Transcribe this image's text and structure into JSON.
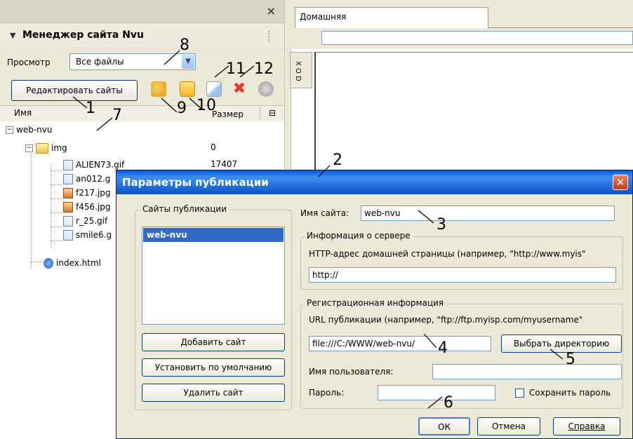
{
  "site_manager": {
    "title": "Менеджер сайта Nvu",
    "close_glyph": "×",
    "view_label": "Просмотр",
    "view_select_value": "Все файлы",
    "edit_sites_button": "Редактировать сайты",
    "columns": {
      "name": "Имя",
      "size": "Размер"
    },
    "tree": [
      {
        "name": "web-nvu",
        "size": "",
        "type": "site"
      },
      {
        "name": "img",
        "size": "0",
        "type": "folder"
      },
      {
        "name": "ALIEN73.gif",
        "size": "17407",
        "type": "gif"
      },
      {
        "name": "an012.g",
        "size": "",
        "type": "gif"
      },
      {
        "name": "f217.jpg",
        "size": "",
        "type": "jpg"
      },
      {
        "name": "f456.jpg",
        "size": "",
        "type": "jpg"
      },
      {
        "name": "r_25.gif",
        "size": "",
        "type": "gif"
      },
      {
        "name": "smile6.g",
        "size": "",
        "type": "gif"
      },
      {
        "name": "index.html",
        "size": "",
        "type": "html"
      }
    ]
  },
  "editor": {
    "tab_label": "Домашняя",
    "side_tab": "X O D"
  },
  "dialog": {
    "title": "Параметры публикации",
    "close_glyph": "✕",
    "sites_group_label": "Сайты публикации",
    "sites": [
      "web-nvu"
    ],
    "add_site_button": "Добавить сайт",
    "set_default_button": "Установить по умолчанию",
    "delete_site_button": "Удалить сайт",
    "site_name_label": "Имя сайта:",
    "site_name_value": "web-nvu",
    "server_group_label": "Информация о сервере",
    "http_address_label": "HTTP-адрес домашней страницы (например, \"http://www.myis\"",
    "http_address_value": "http://",
    "registration_group_label": "Регистрационная информация",
    "publish_url_label": "URL публикации (например, \"ftp://ftp.myisp.com/myusername\"",
    "publish_url_value": "file:///C:/WWW/web-nvu/",
    "choose_dir_button": "Выбрать директорию",
    "username_label": "Имя пользователя:",
    "username_value": "",
    "password_label": "Пароль:",
    "password_value": "",
    "save_password_label": "Сохранить пароль",
    "ok_button": "ОК",
    "cancel_button": "Отмена",
    "help_button": "Справка"
  },
  "callouts": [
    "1",
    "2",
    "3",
    "4",
    "5",
    "6",
    "7",
    "8",
    "9",
    "10",
    "11",
    "12"
  ]
}
